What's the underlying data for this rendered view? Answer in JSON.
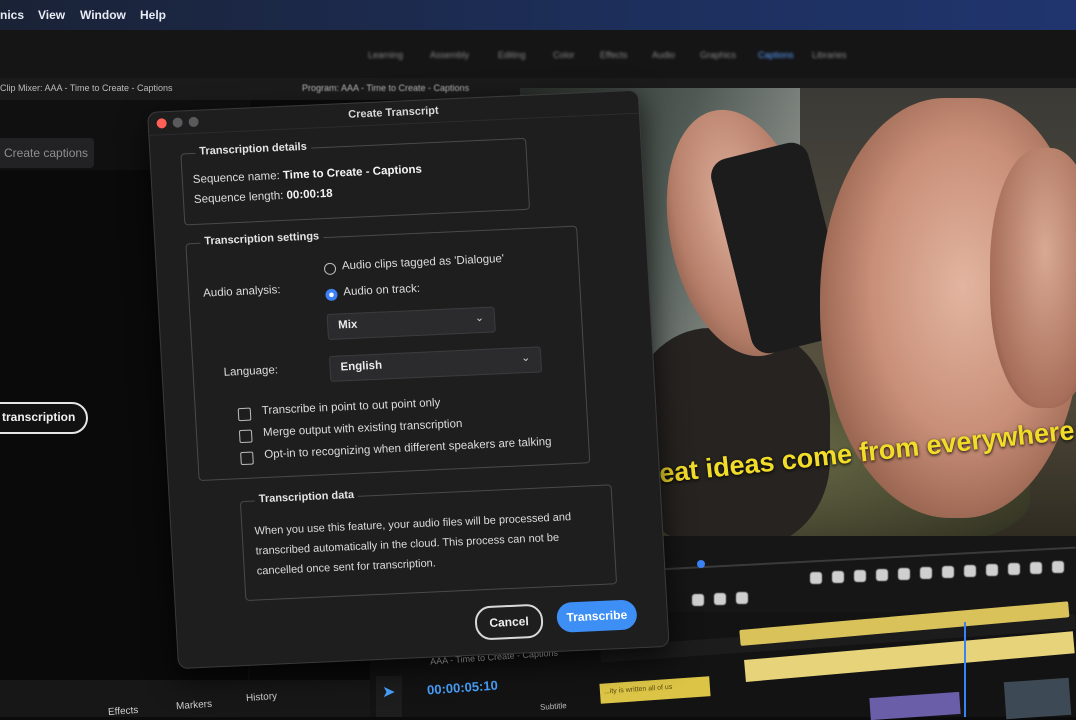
{
  "menu": [
    "nics",
    "View",
    "Window",
    "Help"
  ],
  "workspaces": [
    "Learning",
    "Assembly",
    "Editing",
    "Color",
    "Effects",
    "Audio",
    "Graphics",
    "Captions",
    "Libraries"
  ],
  "panels": {
    "left_tab": "Clip Mixer: AAA - Time to Create - Captions",
    "program_tab": "Program: AAA - Time to Create - Captions",
    "create_captions": "Create captions",
    "transcription_button": "transcription"
  },
  "dialog": {
    "title": "Create Transcript",
    "details": {
      "legend": "Transcription details",
      "seq_name_label": "Sequence name:",
      "seq_name_value": "Time to Create - Captions",
      "seq_length_label": "Sequence length:",
      "seq_length_value": "00:00:18"
    },
    "settings": {
      "legend": "Transcription settings",
      "audio_analysis_label": "Audio analysis:",
      "option_dialogue": "Audio clips tagged as 'Dialogue'",
      "option_track": "Audio on track:",
      "track_value": "Mix",
      "language_label": "Language:",
      "language_value": "English",
      "checkbox_in_out": "Transcribe in point to out point only",
      "checkbox_merge": "Merge output with existing transcription",
      "checkbox_speakers": "Opt-in to recognizing when different speakers are talking"
    },
    "data": {
      "legend": "Transcription data",
      "line1": "When you use this feature, your audio files will be processed and",
      "line2": "transcribed automatically in the cloud. This process can not be",
      "line3": "cancelled once sent for transcription."
    },
    "cancel_label": "Cancel",
    "transcribe_label": "Transcribe"
  },
  "video": {
    "caption_text": "Great ideas come from everywhere"
  },
  "timeline": {
    "sequence_title": "AAA - Time to Create - Captions",
    "timecode": "00:00:05:10",
    "subtitle_label": "Subtitle",
    "clip_text": "...ity is written all of us"
  },
  "bottom_tabs": [
    "Effects",
    "Markers",
    "History"
  ],
  "colors": {
    "accent": "#3d8ef5",
    "caption_yellow": "#f2dc2a",
    "timecode_blue": "#4aa3ff"
  }
}
